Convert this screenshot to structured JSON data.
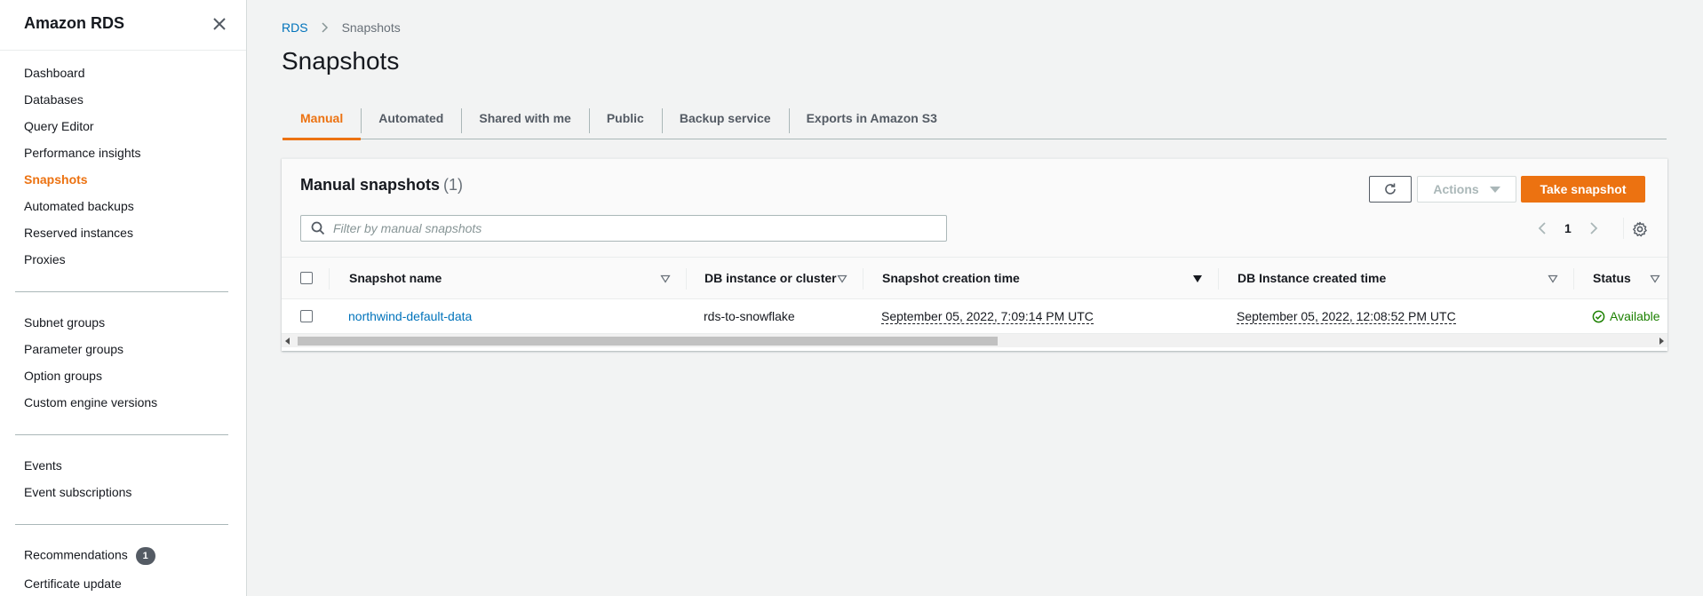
{
  "sidebar": {
    "title": "Amazon RDS",
    "items": [
      {
        "label": "Dashboard"
      },
      {
        "label": "Databases"
      },
      {
        "label": "Query Editor"
      },
      {
        "label": "Performance insights"
      },
      {
        "label": "Snapshots",
        "active": true
      },
      {
        "label": "Automated backups"
      },
      {
        "label": "Reserved instances"
      },
      {
        "label": "Proxies"
      },
      {
        "label": "Subnet groups"
      },
      {
        "label": "Parameter groups"
      },
      {
        "label": "Option groups"
      },
      {
        "label": "Custom engine versions"
      },
      {
        "label": "Events"
      },
      {
        "label": "Event subscriptions"
      },
      {
        "label": "Recommendations",
        "badge": "1"
      },
      {
        "label": "Certificate update"
      }
    ]
  },
  "breadcrumb": {
    "root": "RDS",
    "current": "Snapshots"
  },
  "page": {
    "title": "Snapshots"
  },
  "tabs": [
    {
      "label": "Manual",
      "active": true
    },
    {
      "label": "Automated"
    },
    {
      "label": "Shared with me"
    },
    {
      "label": "Public"
    },
    {
      "label": "Backup service"
    },
    {
      "label": "Exports in Amazon S3"
    }
  ],
  "panel": {
    "title": "Manual snapshots",
    "count": "(1)",
    "actions_label": "Actions",
    "take_snapshot_label": "Take snapshot",
    "search_placeholder": "Filter by manual snapshots",
    "page_number": "1"
  },
  "table": {
    "columns": [
      "Snapshot name",
      "DB instance or cluster",
      "Snapshot creation time",
      "DB Instance created time",
      "Status"
    ],
    "rows": [
      {
        "snapshot_name": "northwind-default-data",
        "db_instance": "rds-to-snowflake",
        "snapshot_time": "September 05, 2022, 7:09:14 PM UTC",
        "instance_created": "September 05, 2022, 12:08:52 PM UTC",
        "status": "Available"
      }
    ]
  },
  "colors": {
    "accent": "#ec7211",
    "link": "#0073bb",
    "success": "#1d8102"
  }
}
